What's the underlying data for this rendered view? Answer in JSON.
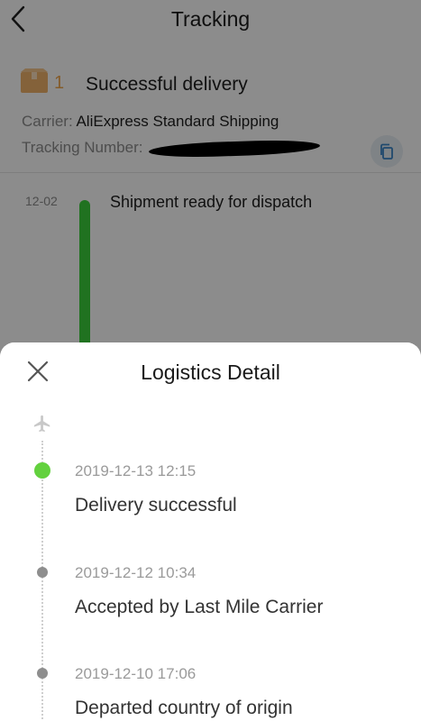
{
  "header": {
    "title": "Tracking"
  },
  "package": {
    "count": "1",
    "status": "Successful delivery",
    "carrier_label": "Carrier:",
    "carrier_value": "AliExpress Standard Shipping",
    "tracking_label": "Tracking Number:"
  },
  "background_events": [
    {
      "date": "12-02",
      "text": "Shipment ready for dispatch"
    }
  ],
  "sheet": {
    "title": "Logistics Detail",
    "events": [
      {
        "time": "2019-12-13 12:15",
        "description": "Delivery successful",
        "state": "active"
      },
      {
        "time": "2019-12-12 10:34",
        "description": "Accepted by Last Mile Carrier",
        "state": "inactive"
      },
      {
        "time": "2019-12-10 17:06",
        "description": "Departed country of origin",
        "state": "inactive"
      }
    ]
  },
  "icons": {
    "back": "chevron-left-icon",
    "package": "package-box-icon",
    "copy": "copy-icon",
    "close": "close-icon",
    "plane": "airplane-icon"
  },
  "colors": {
    "delivered_green": "#3bd03b",
    "active_dot": "#63d13e",
    "inactive_dot": "#8e8e8e",
    "package_orange": "#f0a64b"
  }
}
